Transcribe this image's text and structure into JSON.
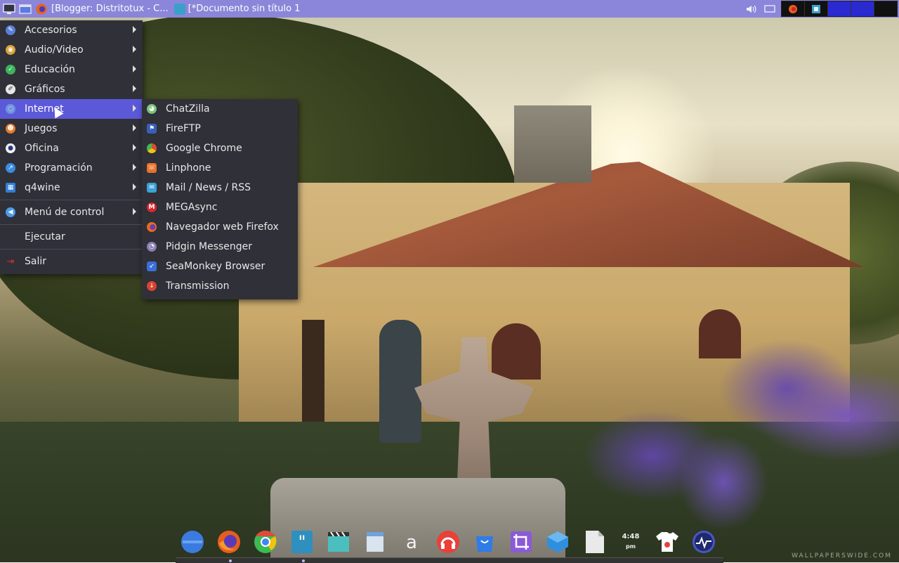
{
  "taskbar": {
    "tasks": [
      {
        "label": "[Blogger: Distritotux - C...",
        "icon": "firefox-icon"
      },
      {
        "label": "[*Documento sin título 1",
        "icon": "document-icon"
      }
    ],
    "tray_icons": [
      "volume-icon",
      "display-icon",
      "firefox-tray-icon",
      "app-tray-icon"
    ],
    "pager_colors": [
      "#111111",
      "#111111",
      "#2a2ad0",
      "#2a2ad0",
      "#111111"
    ]
  },
  "main_menu": {
    "items": [
      {
        "label": "Accesorios",
        "icon": "accessories-icon",
        "color": "#5b7fd6"
      },
      {
        "label": "Audio/Video",
        "icon": "multimedia-icon",
        "color": "#d8a23c"
      },
      {
        "label": "Educación",
        "icon": "education-icon",
        "color": "#3cb55c"
      },
      {
        "label": "Gráficos",
        "icon": "graphics-icon",
        "color": "#e6e6e6"
      },
      {
        "label": "Internet",
        "icon": "internet-icon",
        "color": "#6f93e0"
      },
      {
        "label": "Juegos",
        "icon": "games-icon",
        "color": "#e87b2a"
      },
      {
        "label": "Oficina",
        "icon": "office-icon",
        "color": "#f0f0f0"
      },
      {
        "label": "Programación",
        "icon": "development-icon",
        "color": "#3b8de0"
      },
      {
        "label": "q4wine",
        "icon": "wine-icon",
        "color": "#2f7fd6"
      },
      {
        "label": "Menú de control",
        "icon": "control-icon",
        "color": "#4a9be8"
      },
      {
        "label": "Ejecutar",
        "icon": "",
        "color": ""
      },
      {
        "label": "Salir",
        "icon": "exit-icon",
        "color": "#c33"
      }
    ]
  },
  "sub_menu": {
    "items": [
      {
        "label": "ChatZilla",
        "icon": "chatzilla-icon",
        "color": "#7bc47a"
      },
      {
        "label": "FireFTP",
        "icon": "fireftp-icon",
        "color": "#3a5fb8"
      },
      {
        "label": "Google Chrome",
        "icon": "chrome-icon",
        "color": "#dd4b39"
      },
      {
        "label": "Linphone",
        "icon": "linphone-icon",
        "color": "#e8702a"
      },
      {
        "label": "Mail / News / RSS",
        "icon": "mail-icon",
        "color": "#3aa2d8"
      },
      {
        "label": "MEGAsync",
        "icon": "mega-icon",
        "color": "#d9272e"
      },
      {
        "label": "Navegador web Firefox",
        "icon": "firefox-icon",
        "color": "#e66a1f"
      },
      {
        "label": "Pidgin Messenger",
        "icon": "pidgin-icon",
        "color": "#8a7fb0"
      },
      {
        "label": "SeaMonkey Browser",
        "icon": "seamonkey-icon",
        "color": "#3a6fd8"
      },
      {
        "label": "Transmission",
        "icon": "transmission-icon",
        "color": "#d8432f"
      }
    ]
  },
  "dock": {
    "items": [
      {
        "name": "files-icon",
        "color": "#3b7be0"
      },
      {
        "name": "firefox-icon",
        "color": "#e85d1f"
      },
      {
        "name": "chrome-icon",
        "color": "#dd4b39"
      },
      {
        "name": "quote-icon",
        "color": "#2f8fbf"
      },
      {
        "name": "video-editor-icon",
        "color": "#4bbfbf"
      },
      {
        "name": "notes-icon",
        "color": "#d8e4ef"
      },
      {
        "name": "font-icon",
        "color": "#f2f2f2"
      },
      {
        "name": "music-icon",
        "color": "#e8403a"
      },
      {
        "name": "store-icon",
        "color": "#2f7be8"
      },
      {
        "name": "crop-icon",
        "color": "#8a5ad8"
      },
      {
        "name": "package-icon",
        "color": "#2f8fdf"
      },
      {
        "name": "document-icon",
        "color": "#e9e9e9"
      },
      {
        "name": "clock-icon",
        "color": "#eeeeee"
      },
      {
        "name": "shirt-icon",
        "color": "#ffffff"
      },
      {
        "name": "monitor-icon",
        "color": "#4a55c8"
      }
    ],
    "clock": {
      "time": "4:48",
      "ampm": "pm"
    }
  },
  "wallpaper": {
    "watermark": "WALLPAPERSWIDE.COM"
  }
}
